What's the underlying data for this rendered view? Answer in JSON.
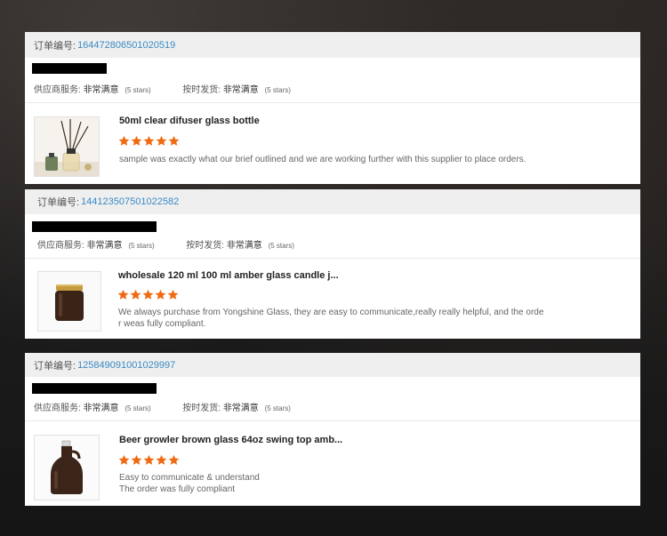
{
  "labels": {
    "order_no": "订单编号:",
    "supplier_service": "供应商服务:",
    "on_time_delivery": "按时发货:",
    "rating_value": "非常满意",
    "stars_text": "(5 stars)"
  },
  "colors": {
    "star": "#f06a12",
    "order_link": "#3a8ac4"
  },
  "icons": {
    "star": "star-icon"
  },
  "reviews": [
    {
      "order_number": "164472806501020519",
      "product_title": "50ml clear difuser glass bottle",
      "rating": 5,
      "comment_lines": [
        "sample was exactly what our brief outlined and we are working further with this supplier to place orders."
      ]
    },
    {
      "order_number": "144123507501022582",
      "product_title": "wholesale 120 ml 100 ml amber glass candle j...",
      "rating": 5,
      "comment_lines": [
        "We always purchase from Yongshine Glass, they are easy to communicate,really really helpful, and the orde",
        "r weas fully compliant."
      ]
    },
    {
      "order_number": "125849091001029997",
      "product_title": "Beer growler brown glass 64oz swing top amb...",
      "rating": 5,
      "comment_lines": [
        "Easy to communicate & understand",
        "The order was fully compliant"
      ]
    }
  ]
}
